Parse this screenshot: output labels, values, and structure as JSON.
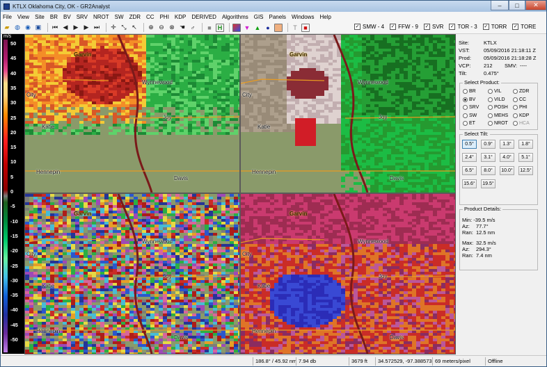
{
  "window": {
    "title": "KTLX Oklahoma City, OK - GR2Analyst",
    "min": "–",
    "max": "□",
    "close": "✕"
  },
  "menu": [
    "File",
    "View",
    "Site",
    "BR",
    "BV",
    "SRV",
    "NROT",
    "SW",
    "ZDR",
    "CC",
    "PHI",
    "KDP",
    "DERIVED",
    "Algorithms",
    "GIS",
    "Panels",
    "Windows",
    "Help"
  ],
  "warnings": [
    {
      "label": "SMW - 4",
      "checked": true
    },
    {
      "label": "FFW - 9",
      "checked": true
    },
    {
      "label": "SVR",
      "checked": true
    },
    {
      "label": "TOR - 3",
      "checked": true
    },
    {
      "label": "TORR",
      "checked": true
    },
    {
      "label": "TORE",
      "checked": true
    }
  ],
  "legend": {
    "unit": "m/s",
    "ticks": [
      "50",
      "45",
      "40",
      "35",
      "30",
      "25",
      "20",
      "15",
      "10",
      "5",
      "0",
      "-5",
      "-10",
      "-15",
      "-20",
      "-25",
      "-30",
      "-35",
      "-40",
      "-45",
      "-50"
    ]
  },
  "map_labels": {
    "garvin": "Garvin",
    "wynnewood": "Wynnewood",
    "joy": "Joy",
    "city": "City",
    "katie": "Katie",
    "hennepin": "Hennepin",
    "davis": "Davis"
  },
  "site_info": {
    "site_label": "Site:",
    "site": "KTLX",
    "vst_label": "VST:",
    "vst": "05/09/2016  21:18:11 Z",
    "prod_label": "Prod:",
    "prod": "05/09/2016  21:18:28 Z",
    "vcp_label": "VCP:",
    "vcp": "212",
    "smv_label": "SMV:",
    "smv": "----",
    "tilt_label": "Tilt:",
    "tilt": "0.475°"
  },
  "select_product": {
    "title": "Select Product:",
    "items": [
      "BR",
      "VIL",
      "ZDR",
      "BV",
      "VILD",
      "CC",
      "SRV",
      "POSH",
      "PHI",
      "SW",
      "MEHS",
      "KDP",
      "ET",
      "NROT",
      "HCA"
    ],
    "selected": "BV"
  },
  "select_tilt": {
    "title": "Select Tilt:",
    "items": [
      "0.5°",
      "0.9°",
      "1.3°",
      "1.8°",
      "2.4°",
      "3.1°",
      "4.0°",
      "5.1°",
      "6.5°",
      "8.0°",
      "10.0°",
      "12.5°",
      "15.6°",
      "19.5°"
    ],
    "selected": "0.5°"
  },
  "product_details": {
    "title": "Product Details:",
    "min_label": "Min:",
    "min": "-39.5 m/s",
    "min_az_label": "Az:",
    "min_az": "77.7°",
    "min_ran_label": "Ran:",
    "min_ran": "12.5 nm",
    "max_label": "Max:",
    "max": "32.5 m/s",
    "max_az_label": "Az:",
    "max_az": "294.3°",
    "max_ran_label": "Ran:",
    "max_ran": "7.4 nm"
  },
  "status": {
    "bearing": "186.8° / 45.92 nm",
    "db": "7.94 db",
    "alt": "3679 ft",
    "latlon": "34.572529, -97.388573",
    "scale": "69 meters/pixel",
    "state": "Offline"
  }
}
